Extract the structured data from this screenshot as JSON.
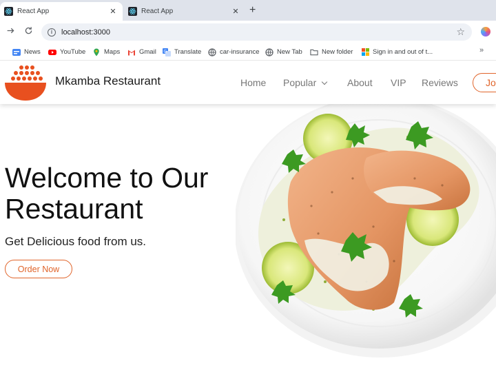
{
  "browser": {
    "tabs": [
      {
        "title": "React App",
        "close": "✕"
      },
      {
        "title": "React App",
        "close": "✕"
      }
    ],
    "new_tab": "+",
    "url": "localhost:3000",
    "bookmarks": [
      {
        "label": "News",
        "icon": "news-icon"
      },
      {
        "label": "YouTube",
        "icon": "youtube-icon"
      },
      {
        "label": "Maps",
        "icon": "maps-icon"
      },
      {
        "label": "Gmail",
        "icon": "gmail-icon"
      },
      {
        "label": "Translate",
        "icon": "translate-icon"
      },
      {
        "label": "car-insurance",
        "icon": "globe-icon"
      },
      {
        "label": "New Tab",
        "icon": "globe-icon"
      },
      {
        "label": "New folder",
        "icon": "folder-icon"
      },
      {
        "label": "Sign in and out of t...",
        "icon": "microsoft-icon"
      }
    ],
    "bookmarks_more": "»"
  },
  "site": {
    "brand": "Mkamba Restaurant",
    "nav": {
      "home": "Home",
      "popular": "Popular",
      "about": "About",
      "vip": "VIP",
      "reviews": "Reviews",
      "join": "Jo"
    },
    "hero": {
      "title_line1": "Welcome to Our",
      "title_line2": "Restaurant",
      "subtitle": "Get Delicious food from us.",
      "cta": "Order Now"
    },
    "colors": {
      "accent": "#e0642a",
      "logo_bowl": "#e8501f"
    }
  }
}
